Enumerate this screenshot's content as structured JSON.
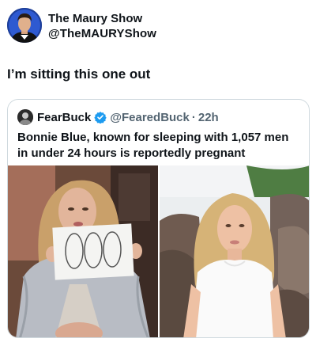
{
  "author": {
    "display_name": "The Maury Show",
    "handle": "@TheMAURYShow",
    "avatar_icon": "host-portrait-avatar"
  },
  "tweet": {
    "text": "I’m sitting this one out"
  },
  "quoted": {
    "display_name": "FearBuck",
    "verified_icon": "verified-badge-icon",
    "handle": "@FearedBuck",
    "separator": "·",
    "time": "22h",
    "text": "Bonnie Blue, known for sleeping with 1,057 men in under 24 hours is reportedly pregnant",
    "photos": [
      "woman-holding-drawing-photo",
      "woman-white-tshirt-photo"
    ]
  },
  "colors": {
    "text": "#0f1419",
    "muted": "#536471",
    "border": "#cfd9de",
    "verified": "#1d9bf0"
  }
}
